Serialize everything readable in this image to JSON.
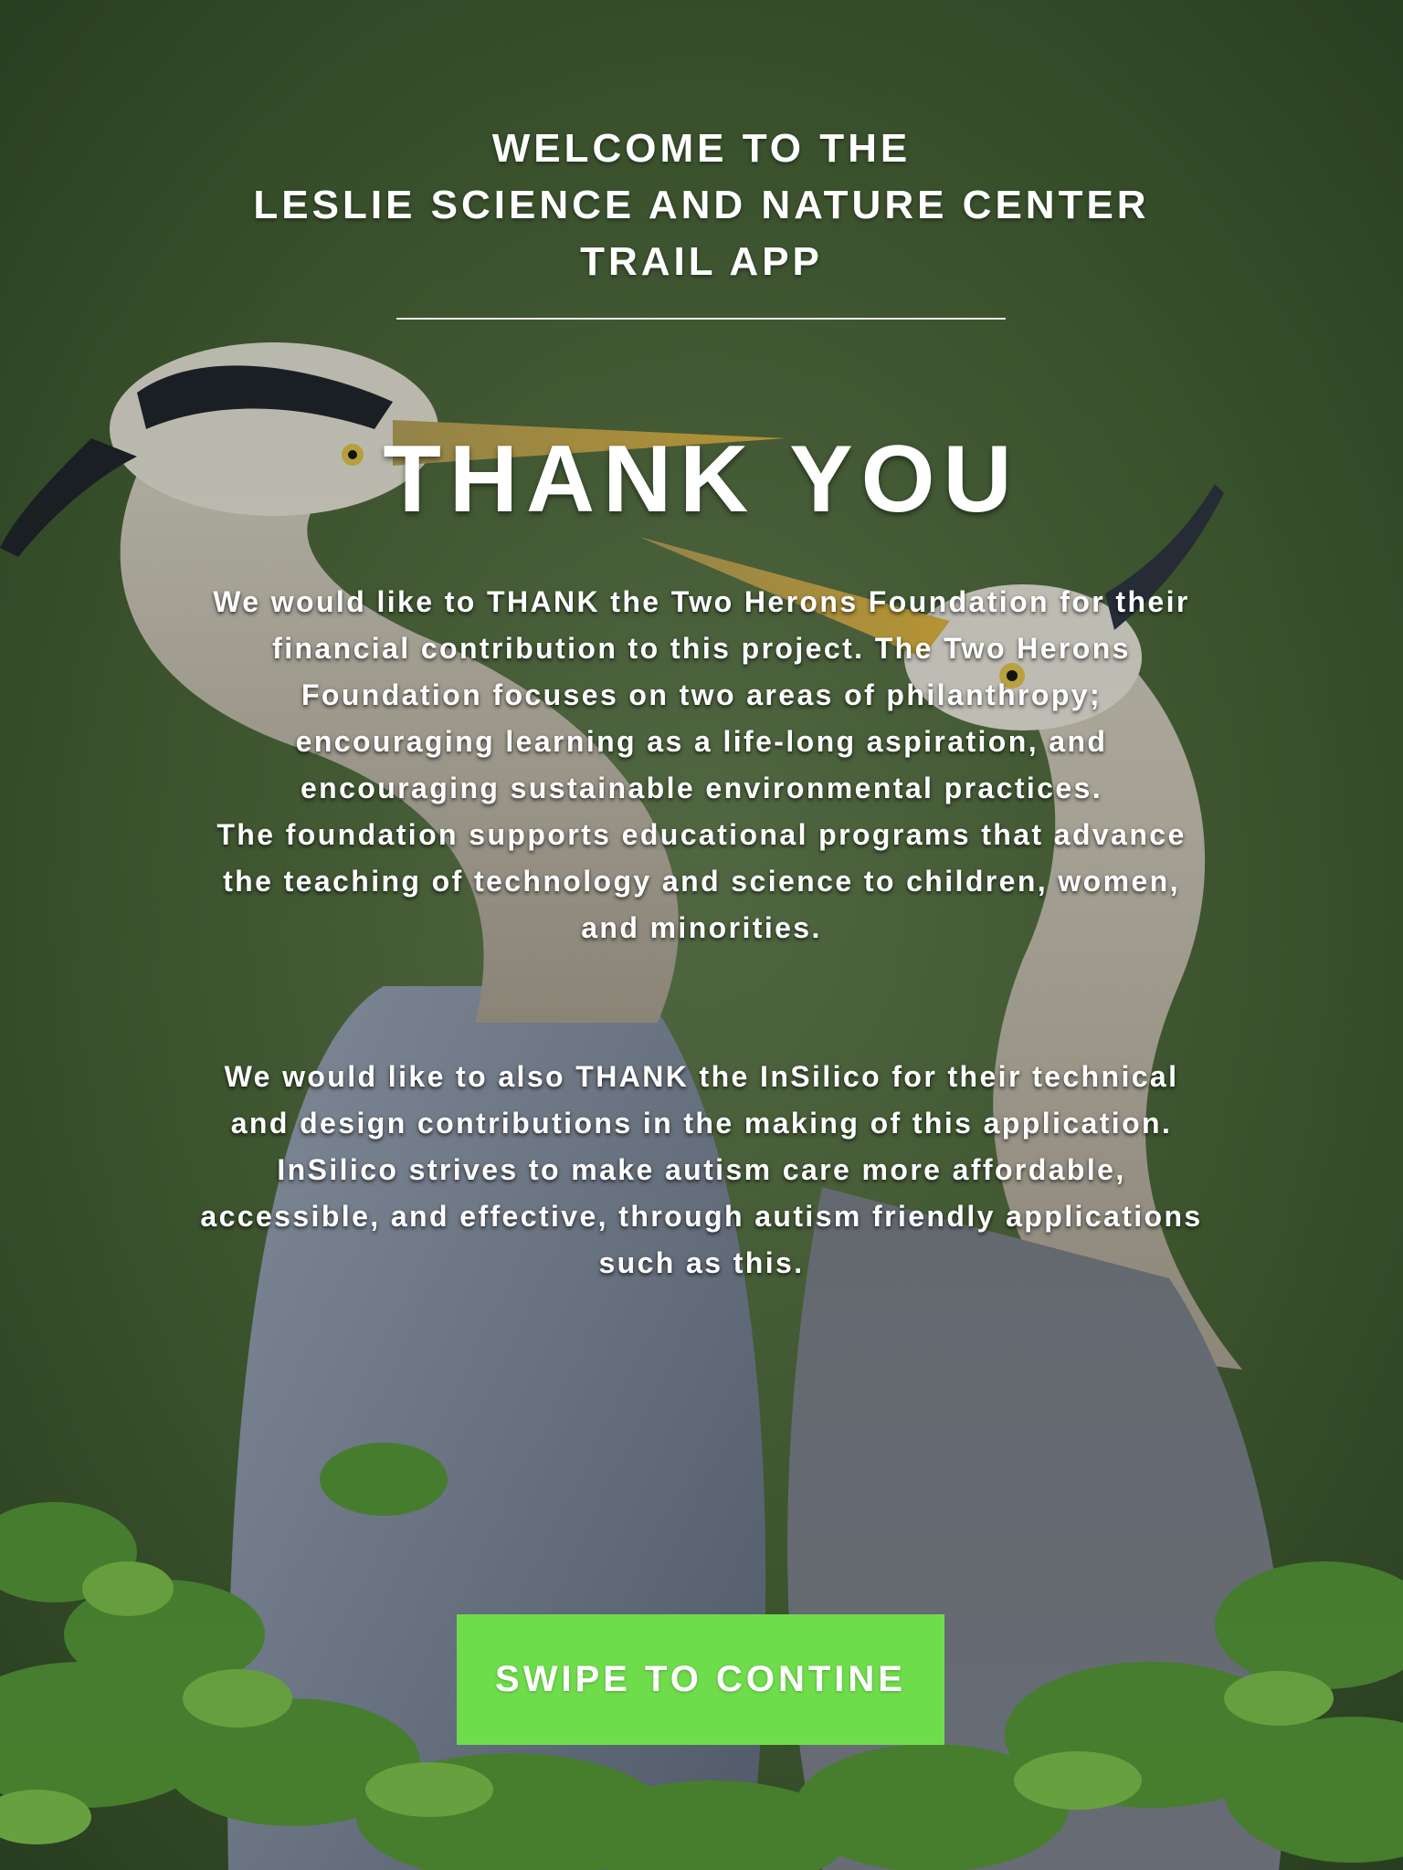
{
  "header": {
    "lines": [
      "WELCOME TO THE",
      "LESLIE SCIENCE AND NATURE CENTER",
      "TRAIL APP"
    ]
  },
  "thank_you": {
    "title": "THANK YOU",
    "paragraph_1": [
      "We would like to THANK the Two Herons Foundation for their",
      "financial contribution to this project.  The Two Herons",
      "Foundation focuses on two areas of philanthropy;",
      "encouraging learning as a life-long aspiration, and",
      "encouraging sustainable environmental practices.",
      "The foundation supports educational programs that advance",
      "the teaching of technology and science to children, women,",
      "and minorities."
    ],
    "paragraph_2": [
      "We would like to also THANK the InSilico for their technical",
      "and design contributions in the making of this application.",
      "InSilico strives to make autism care more affordable,",
      "accessible, and effective, through autism friendly applications",
      "such as this."
    ]
  },
  "cta": {
    "label": "SWIPE TO CONTINE"
  },
  "colors": {
    "button": "#6fdc4c",
    "text": "#ffffff",
    "background": "#3d5a2e"
  },
  "background_image": "two great blue herons with foliage"
}
